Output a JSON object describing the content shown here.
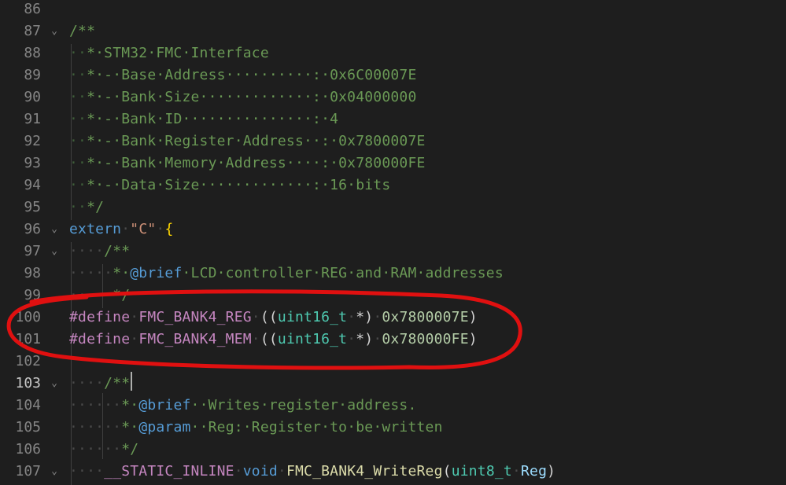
{
  "editor": {
    "lines": [
      {
        "n": "86",
        "fold": "",
        "segments": []
      },
      {
        "n": "87",
        "fold": "⌄",
        "segments": [
          {
            "c": "cmt",
            "t": "/**"
          }
        ]
      },
      {
        "n": "88",
        "fold": "",
        "segments": [
          {
            "c": "ws",
            "t": "··"
          },
          {
            "c": "cmt",
            "t": "*·STM32·FMC·Interface"
          }
        ]
      },
      {
        "n": "89",
        "fold": "",
        "segments": [
          {
            "c": "ws",
            "t": "··"
          },
          {
            "c": "cmt",
            "t": "*·-·Base·Address··········:·0x6C00007E"
          }
        ]
      },
      {
        "n": "90",
        "fold": "",
        "segments": [
          {
            "c": "ws",
            "t": "··"
          },
          {
            "c": "cmt",
            "t": "*·-·Bank·Size·············:·0x04000000"
          }
        ]
      },
      {
        "n": "91",
        "fold": "",
        "segments": [
          {
            "c": "ws",
            "t": "··"
          },
          {
            "c": "cmt",
            "t": "*·-·Bank·ID···············:·4"
          }
        ]
      },
      {
        "n": "92",
        "fold": "",
        "segments": [
          {
            "c": "ws",
            "t": "··"
          },
          {
            "c": "cmt",
            "t": "*·-·Bank·Register·Address··:·0x7800007E"
          }
        ]
      },
      {
        "n": "93",
        "fold": "",
        "segments": [
          {
            "c": "ws",
            "t": "··"
          },
          {
            "c": "cmt",
            "t": "*·-·Bank·Memory·Address····:·0x780000FE"
          }
        ]
      },
      {
        "n": "94",
        "fold": "",
        "segments": [
          {
            "c": "ws",
            "t": "··"
          },
          {
            "c": "cmt",
            "t": "*·-·Data·Size·············:·16·bits"
          }
        ]
      },
      {
        "n": "95",
        "fold": "",
        "segments": [
          {
            "c": "ws",
            "t": "··"
          },
          {
            "c": "cmt",
            "t": "*/"
          }
        ]
      },
      {
        "n": "96",
        "fold": "⌄",
        "segments": [
          {
            "c": "kw",
            "t": "extern"
          },
          {
            "c": "ws-d",
            "t": "·"
          },
          {
            "c": "str",
            "t": "\"C\""
          },
          {
            "c": "ws-d",
            "t": "·"
          },
          {
            "c": "brace",
            "t": "{"
          }
        ]
      },
      {
        "n": "97",
        "fold": "⌄",
        "segments": [
          {
            "c": "ws-d",
            "t": "····"
          },
          {
            "c": "cmt",
            "t": "/**"
          }
        ]
      },
      {
        "n": "98",
        "fold": "",
        "segments": [
          {
            "c": "ws-d",
            "t": "·····"
          },
          {
            "c": "cmt",
            "t": "*·"
          },
          {
            "c": "doc",
            "t": "@brief"
          },
          {
            "c": "cmt",
            "t": "·LCD·controller·REG·and·RAM·addresses"
          }
        ]
      },
      {
        "n": "99",
        "fold": "",
        "segments": [
          {
            "c": "ws-d",
            "t": "·····"
          },
          {
            "c": "cmt",
            "t": "*/"
          }
        ]
      },
      {
        "n": "100",
        "fold": "",
        "segments": [
          {
            "c": "pp",
            "t": "#define"
          },
          {
            "c": "ws-d",
            "t": "·"
          },
          {
            "c": "mac",
            "t": "FMC_BANK4_REG"
          },
          {
            "c": "ws-d",
            "t": "·"
          },
          {
            "c": "txt",
            "t": "(("
          },
          {
            "c": "typ",
            "t": "uint16_t"
          },
          {
            "c": "ws-d",
            "t": "·"
          },
          {
            "c": "txt",
            "t": "*)"
          },
          {
            "c": "ws-d",
            "t": "·"
          },
          {
            "c": "num",
            "t": "0x7800007E"
          },
          {
            "c": "txt",
            "t": ")"
          }
        ]
      },
      {
        "n": "101",
        "fold": "",
        "segments": [
          {
            "c": "pp",
            "t": "#define"
          },
          {
            "c": "ws-d",
            "t": "·"
          },
          {
            "c": "mac",
            "t": "FMC_BANK4_MEM"
          },
          {
            "c": "ws-d",
            "t": "·"
          },
          {
            "c": "txt",
            "t": "(("
          },
          {
            "c": "typ",
            "t": "uint16_t"
          },
          {
            "c": "ws-d",
            "t": "·"
          },
          {
            "c": "txt",
            "t": "*)"
          },
          {
            "c": "ws-d",
            "t": "·"
          },
          {
            "c": "num",
            "t": "0x780000FE"
          },
          {
            "c": "txt",
            "t": ")"
          }
        ]
      },
      {
        "n": "102",
        "fold": "",
        "segments": []
      },
      {
        "n": "103",
        "fold": "⌄",
        "active": true,
        "segments": [
          {
            "c": "ws-d",
            "t": "····"
          },
          {
            "c": "cmt",
            "t": "/**"
          }
        ]
      },
      {
        "n": "104",
        "fold": "",
        "segments": [
          {
            "c": "ws-d",
            "t": "······"
          },
          {
            "c": "cmt",
            "t": "*·"
          },
          {
            "c": "doc",
            "t": "@brief"
          },
          {
            "c": "cmt",
            "t": "··Writes·register·address."
          }
        ]
      },
      {
        "n": "105",
        "fold": "",
        "segments": [
          {
            "c": "ws-d",
            "t": "······"
          },
          {
            "c": "cmt",
            "t": "*·"
          },
          {
            "c": "doc",
            "t": "@param"
          },
          {
            "c": "cmt",
            "t": "··Reg:·Register·to·be·written"
          }
        ]
      },
      {
        "n": "106",
        "fold": "",
        "segments": [
          {
            "c": "ws-d",
            "t": "······"
          },
          {
            "c": "cmt",
            "t": "*/"
          }
        ]
      },
      {
        "n": "107",
        "fold": "⌄",
        "segments": [
          {
            "c": "ws-d",
            "t": "····"
          },
          {
            "c": "mac",
            "t": "__STATIC_INLINE"
          },
          {
            "c": "ws-d",
            "t": "·"
          },
          {
            "c": "kw",
            "t": "void"
          },
          {
            "c": "ws-d",
            "t": "·"
          },
          {
            "c": "fn",
            "t": "FMC_BANK4_WriteReg"
          },
          {
            "c": "txt",
            "t": "("
          },
          {
            "c": "typ",
            "t": "uint8_t"
          },
          {
            "c": "ws-d",
            "t": "·"
          },
          {
            "c": "par",
            "t": "Reg"
          },
          {
            "c": "txt",
            "t": ")"
          }
        ]
      }
    ]
  },
  "colors": {
    "background": "#1e1e1e",
    "annotation_stroke": "#e01010"
  }
}
